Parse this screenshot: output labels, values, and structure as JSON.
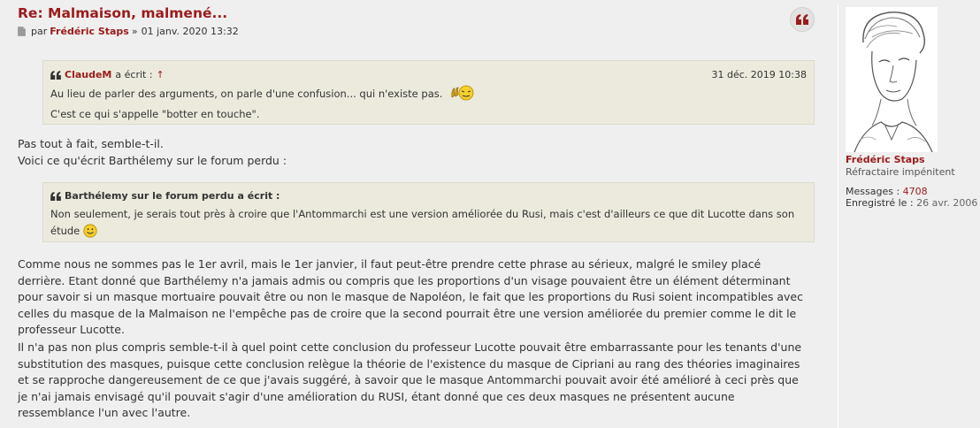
{
  "post": {
    "title": "Re: Malmaison, malmené...",
    "meta_by": "par",
    "author": "Frédéric Staps",
    "meta_sep": "»",
    "datetime": "01 janv. 2020 13:32",
    "quote1": {
      "author": "ClaudeM",
      "suffix": "a écrit :",
      "up_link": "↑",
      "date": "31 déc. 2019 10:38",
      "line1": "Au lieu de parler des arguments, on parle d'une confusion... qui n'existe pas.",
      "line2": "C'est ce qui s'appelle \"botter en touche\"."
    },
    "para1_line1": "Pas tout à fait, semble-t-il.",
    "para1_line2": "Voici ce qu'écrit Barthélemy sur le forum perdu :",
    "quote2": {
      "author": "Barthélemy sur le forum perdu",
      "suffix": "a écrit :",
      "text": "Non seulement, je serais tout près à croire que l'Antommarchi est une version améliorée du Rusi, mais c'est d'ailleurs ce que dit Lucotte dans son étude"
    },
    "para2": "Comme nous ne sommes pas le 1er avril, mais le 1er janvier, il faut peut-être prendre cette phrase au sérieux, malgré le smiley placé derrière. Etant donné que Barthélemy n'a jamais admis ou compris que les proportions d'un visage pouvaient être un élément déterminant pour savoir si un masque mortuaire pouvait être ou non le masque de Napoléon, le fait que les proportions du Rusi soient incompatibles avec celles du masque de la Malmaison ne l'empêche pas de croire que la second pourrait être une version améliorée du premier comme le dit le professeur Lucotte.",
    "para3": "Il n'a pas non plus compris semble-t-il à quel point cette conclusion du professeur Lucotte pouvait être embarrassante pour les tenants d'une substitution des masques, puisque cette conclusion relègue la théorie de l'existence du masque de Cipriani au rang des théories imaginaires et se rapproche dangereusement de ce que j'avais suggéré, à savoir que le masque Antommarchi pouvait avoir été amélioré à ceci près que je n'ai jamais envisagé qu'il pouvait s'agir d'une amélioration du RUSI, étant donné que ces deux masques ne présentent aucune ressemblance l'un avec l'autre."
  },
  "profile": {
    "name": "Frédéric Staps",
    "rank": "Réfractaire impénitent",
    "messages_label": "Messages :",
    "messages_count": "4708",
    "registered_label": "Enregistré le :",
    "registered_date": "26 avr. 2006"
  },
  "colors": {
    "accent": "#9b1b1b",
    "background": "#efefef",
    "quote_bg": "#ebeadd"
  },
  "icons": {
    "doc": "document-icon",
    "quote": "quote-icon",
    "smiley": "smiley-icon"
  }
}
